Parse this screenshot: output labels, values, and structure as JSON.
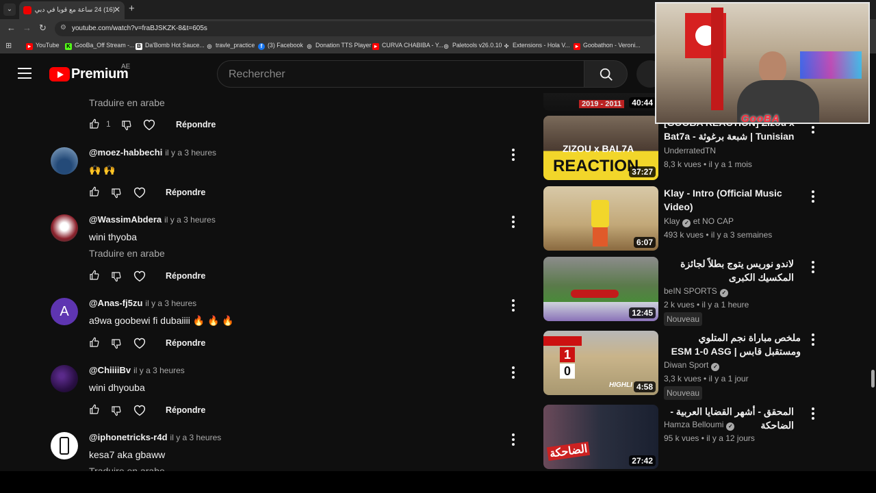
{
  "browser": {
    "tab_title": "(16) 24 ساعة مع قوبا في دبي - ...",
    "url": "youtube.com/watch?v=fraBJSKZK-8&t=605s",
    "bookmarks": [
      {
        "label": "YouTube",
        "icon": "youtube-icon",
        "color": "#ff0000"
      },
      {
        "label": "GooBa_Off Stream -...",
        "icon": "k-icon",
        "color": "#53fc18"
      },
      {
        "label": "Da'Bomb Hot Sauce...",
        "icon": "b-icon",
        "color": "#ffffff"
      },
      {
        "label": "travle_practice",
        "icon": "globe-icon",
        "color": "#cccccc"
      },
      {
        "label": "(3) Facebook",
        "icon": "facebook-icon",
        "color": "#1877f2"
      },
      {
        "label": "Donation TTS Player",
        "icon": "globe-icon",
        "color": "#cccccc"
      },
      {
        "label": "CURVA CHABIBA - Y...",
        "icon": "youtube-icon",
        "color": "#ff0000"
      },
      {
        "label": "Paletools v26.0.10",
        "icon": "globe-icon",
        "color": "#cccccc"
      },
      {
        "label": "Extensions - Hola V...",
        "icon": "puzzle-icon",
        "color": "#cccccc"
      },
      {
        "label": "Goobathon - Veroni...",
        "icon": "youtube-icon",
        "color": "#ff0000"
      }
    ]
  },
  "header": {
    "logo_text": "Premium",
    "country": "AE",
    "search_placeholder": "Rechercher"
  },
  "comments": {
    "translate_label": "Traduire en arabe",
    "reply_label": "Répondre",
    "top_partial": {
      "likes": "1"
    },
    "items": [
      {
        "author": "@moez-habbechi",
        "time": "il y a 3 heures",
        "text": "🙌 🙌",
        "translate": false,
        "avatar_color": "#3b6ea5"
      },
      {
        "author": "@WassimAbdera",
        "time": "il y a 3 heures",
        "text": "wini thyoba",
        "translate": true,
        "avatar_color": "#8a1f2a"
      },
      {
        "author": "@Anas-fj5zu",
        "time": "il y a 3 heures",
        "text": "a9wa goobewi fi dubaiiii 🔥 🔥 🔥",
        "translate": false,
        "avatar_color": "#5e35b1",
        "avatar_letter": "A"
      },
      {
        "author": "@ChiiiiBv",
        "time": "il y a 3 heures",
        "text": "wini dhyouba",
        "translate": false,
        "avatar_color": "#3a1a5e"
      },
      {
        "author": "@iphonetricks-r4d",
        "time": "il y a 3 heures",
        "text": "kesa7 aka gbaww",
        "translate": true,
        "avatar_color": "#ffffff"
      }
    ]
  },
  "sidebar": {
    "videos": [
      {
        "duration": "40:44",
        "thumb_color": "#1a1a1a",
        "thumb_text": "2019 - 2011"
      },
      {
        "title": "[GOOBA REACTION] Zizou x Bat7a - شبعة برغوثة | Tunisian ...",
        "channel": "UnderratedTN",
        "verified": false,
        "meta": "8,3 k vues  •  il y a 1 mois",
        "duration": "37:27",
        "thumb_color": "#3a3a3a",
        "thumb_text": "REACTION",
        "thumb_sub": "ZIZOU x BAL7A"
      },
      {
        "title": "Klay - Intro (Official Music Video)",
        "channel": "Klay",
        "channel_extra": "et NO CAP",
        "verified": true,
        "meta": "493 k vues  •  il y a 3 semaines",
        "duration": "6:07",
        "thumb_color": "#c9b48a"
      },
      {
        "title": "لاندو نوريس يتوج بطلاً لجائزة المكسيك الكبرى",
        "rtl": true,
        "channel": "beIN SPORTS",
        "verified": true,
        "meta": "2 k vues  •  il y a 1 heure",
        "badge": "Nouveau",
        "duration": "12:45",
        "thumb_color": "#7a8f6a"
      },
      {
        "title": "ملخص مباراة نجم المتلوي ومستقبل قابس | ESM 1-0 ASG",
        "channel": "Diwan Sport",
        "verified": true,
        "meta": "3,3 k vues  •  il y a 1 jour",
        "badge": "Nouveau",
        "duration": "4:58",
        "thumb_color": "#b9a98a",
        "thumb_text": "HIGHLI"
      },
      {
        "title": "المحقق - أشهر القضايا العربية - الضاحكة",
        "rtl": true,
        "channel": "Hamza Belloumi",
        "verified": true,
        "meta": "95 k vues  •  il y a 12 jours",
        "duration": "27:42",
        "thumb_color": "#2a2f3f",
        "thumb_text": "الضاحكة"
      }
    ]
  },
  "overlay": {
    "cam_label": "GooBA"
  }
}
